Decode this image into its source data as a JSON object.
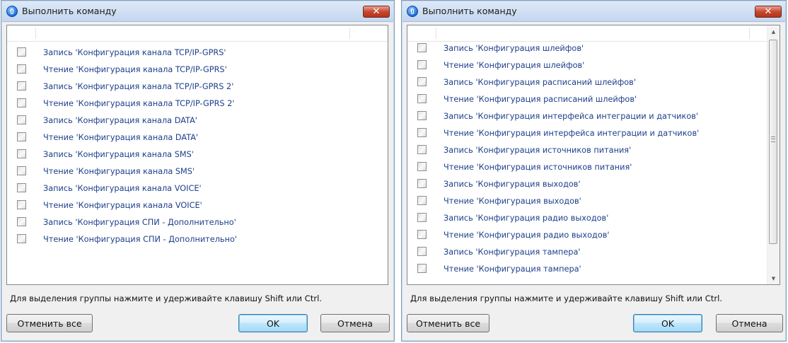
{
  "dialog1": {
    "title": "Выполнить команду",
    "close_glyph": "✕",
    "rows": [
      {
        "label": "Запись 'Конфигурация канала TCP/IP-GPRS'",
        "checked": false
      },
      {
        "label": "Чтение 'Конфигурация канала TCP/IP-GPRS'",
        "checked": false
      },
      {
        "label": "Запись 'Конфигурация канала TCP/IP-GPRS 2'",
        "checked": false
      },
      {
        "label": "Чтение 'Конфигурация канала TCP/IP-GPRS 2'",
        "checked": false
      },
      {
        "label": "Запись 'Конфигурация канала DATA'",
        "checked": false
      },
      {
        "label": "Чтение 'Конфигурация канала DATA'",
        "checked": false
      },
      {
        "label": "Запись 'Конфигурация канала SMS'",
        "checked": false
      },
      {
        "label": "Чтение 'Конфигурация канала SMS'",
        "checked": false
      },
      {
        "label": "Запись 'Конфигурация канала VOICE'",
        "checked": false
      },
      {
        "label": "Чтение 'Конфигурация канала VOICE'",
        "checked": false
      },
      {
        "label": "Запись 'Конфигурация СПИ - Дополнительно'",
        "checked": false
      },
      {
        "label": "Чтение 'Конфигурация СПИ - Дополнительно'",
        "checked": false
      }
    ],
    "hint": "Для выделения группы нажмите и удерживайте клавишу Shift или Ctrl.",
    "buttons": {
      "cancel_all": "Отменить все",
      "ok": "OK",
      "cancel": "Отмена"
    }
  },
  "dialog2": {
    "title": "Выполнить команду",
    "close_glyph": "✕",
    "rows": [
      {
        "label": "Запись 'Конфигурация шлейфов'",
        "checked": false
      },
      {
        "label": "Чтение 'Конфигурация шлейфов'",
        "checked": false
      },
      {
        "label": "Запись 'Конфигурация расписаний шлейфов'",
        "checked": false
      },
      {
        "label": "Чтение 'Конфигурация расписаний шлейфов'",
        "checked": false
      },
      {
        "label": "Запись 'Конфигурация интерфейса интеграции и датчиков'",
        "checked": false
      },
      {
        "label": "Чтение 'Конфигурация интерфейса интеграции и датчиков'",
        "checked": false
      },
      {
        "label": "Запись 'Конфигурация источников питания'",
        "checked": false
      },
      {
        "label": "Чтение 'Конфигурация источников питания'",
        "checked": false
      },
      {
        "label": "Запись 'Конфигурация выходов'",
        "checked": false
      },
      {
        "label": "Чтение 'Конфигурация выходов'",
        "checked": false
      },
      {
        "label": "Запись 'Конфигурация радио выходов'",
        "checked": false
      },
      {
        "label": "Чтение 'Конфигурация радио выходов'",
        "checked": false
      },
      {
        "label": "Запись 'Конфигурация тампера'",
        "checked": false
      },
      {
        "label": "Чтение 'Конфигурация тампера'",
        "checked": false
      }
    ],
    "scroll_up_glyph": "▲",
    "scroll_down_glyph": "▼",
    "hint": "Для выделения группы нажмите и удерживайте клавишу Shift или Ctrl.",
    "buttons": {
      "cancel_all": "Отменить все",
      "ok": "OK",
      "cancel": "Отмена"
    }
  },
  "colors": {
    "row_text": "#1e3f8a",
    "dialog_bg": "#f0f0f0",
    "close_button": "#c8482f"
  }
}
